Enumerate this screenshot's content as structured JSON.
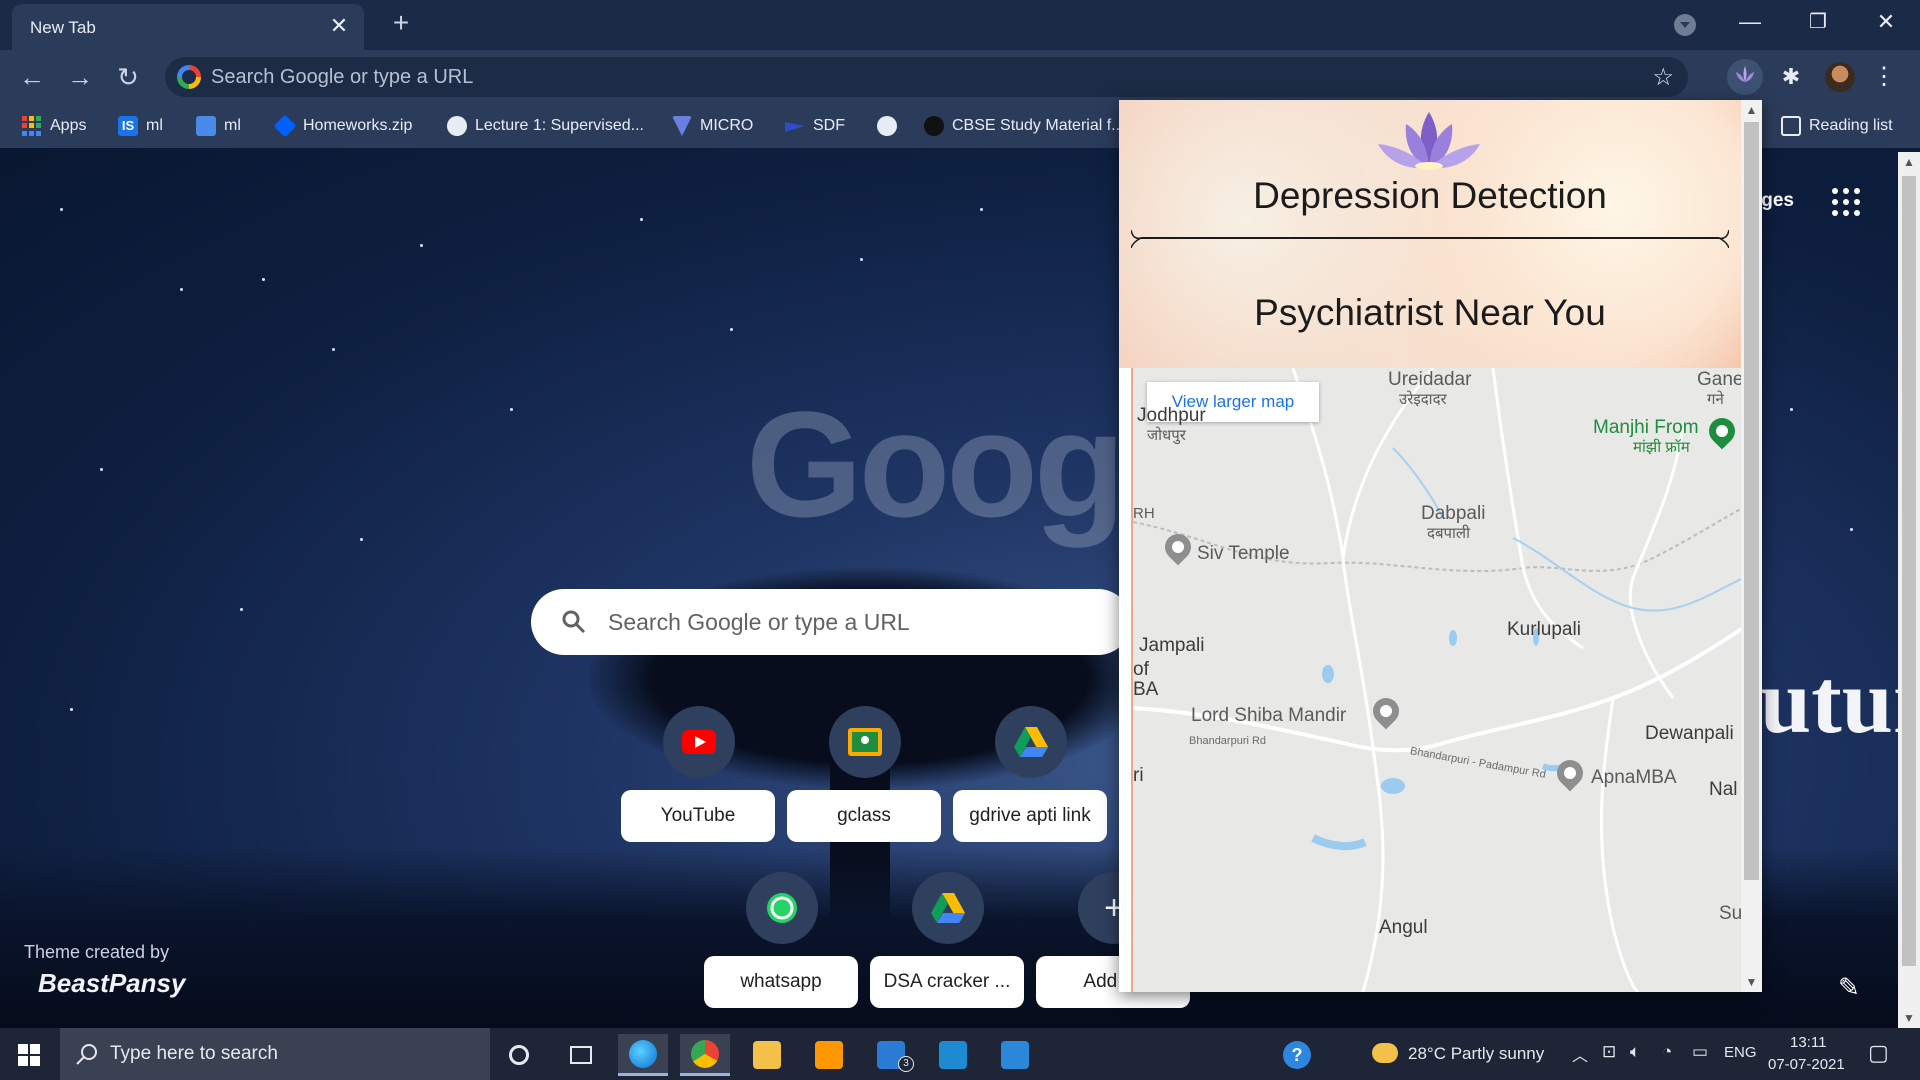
{
  "tab": {
    "title": "New Tab"
  },
  "omnibox": {
    "placeholder": "Search Google or type a URL"
  },
  "bookmarks": [
    {
      "label": "Apps"
    },
    {
      "label": "ml"
    },
    {
      "label": "ml"
    },
    {
      "label": "Homeworks.zip"
    },
    {
      "label": "Lecture 1: Supervised..."
    },
    {
      "label": "MICRO"
    },
    {
      "label": "SDF"
    },
    {
      "label": ""
    },
    {
      "label": "CBSE Study Material f..."
    }
  ],
  "reading_list": "Reading list",
  "ntp": {
    "google_logo": "Google",
    "header_link_partial": "ges",
    "search_placeholder": "Search Google or type a URL",
    "shortcuts": [
      {
        "label": "YouTube",
        "icon": "youtube-icon"
      },
      {
        "label": "gclass",
        "icon": "google-classroom-icon"
      },
      {
        "label": "gdrive apti link",
        "icon": "google-drive-icon"
      },
      {
        "label": "whatsapp",
        "icon": "whatsapp-icon"
      },
      {
        "label": "DSA cracker ...",
        "icon": "google-drive-icon"
      },
      {
        "label": "Add sh",
        "icon": "plus-icon"
      }
    ],
    "theme_credit": "Theme created by",
    "theme_brand": "BeastPansy",
    "background_text": "uture"
  },
  "popup": {
    "title": "Depression Detection",
    "subtitle": "Psychiatrist Near You",
    "map": {
      "view_larger": "View larger map",
      "places": [
        {
          "name": "Ureidadar",
          "local": "उरेइदादर"
        },
        {
          "name": "Gane",
          "local": "गने"
        },
        {
          "name": "Manjhi From",
          "local": "मांझी फ्रॉम"
        },
        {
          "name": "Jodhpur",
          "local": "जोधपुर"
        },
        {
          "name": "RH"
        },
        {
          "name": "Dabpali",
          "local": "दबपाली"
        },
        {
          "name": "Siv Temple"
        },
        {
          "name": "Kurlupali"
        },
        {
          "name": "Jampali"
        },
        {
          "name": "of"
        },
        {
          "name": "BA"
        },
        {
          "name": "Lord Shiba Mandir"
        },
        {
          "name": "Bhandarpuri Rd"
        },
        {
          "name": "Dewanpali"
        },
        {
          "name": "Bhandarpuri - Padampur Rd"
        },
        {
          "name": "ApnaMBA"
        },
        {
          "name": "ri"
        },
        {
          "name": "Nal"
        },
        {
          "name": "Su"
        },
        {
          "name": "Angul"
        }
      ]
    }
  },
  "taskbar": {
    "search_placeholder": "Type here to search",
    "weather": "28°C  Partly sunny",
    "language": "ENG",
    "time": "13:11",
    "date": "07-07-2021",
    "mail_badge": "3"
  },
  "colors": {
    "chrome_dark": "#2b3c5b",
    "accent_blue": "#1a73e8",
    "youtube_red": "#ff0000",
    "whatsapp_green": "#25d366",
    "popup_peach": "#f8d7c2"
  }
}
